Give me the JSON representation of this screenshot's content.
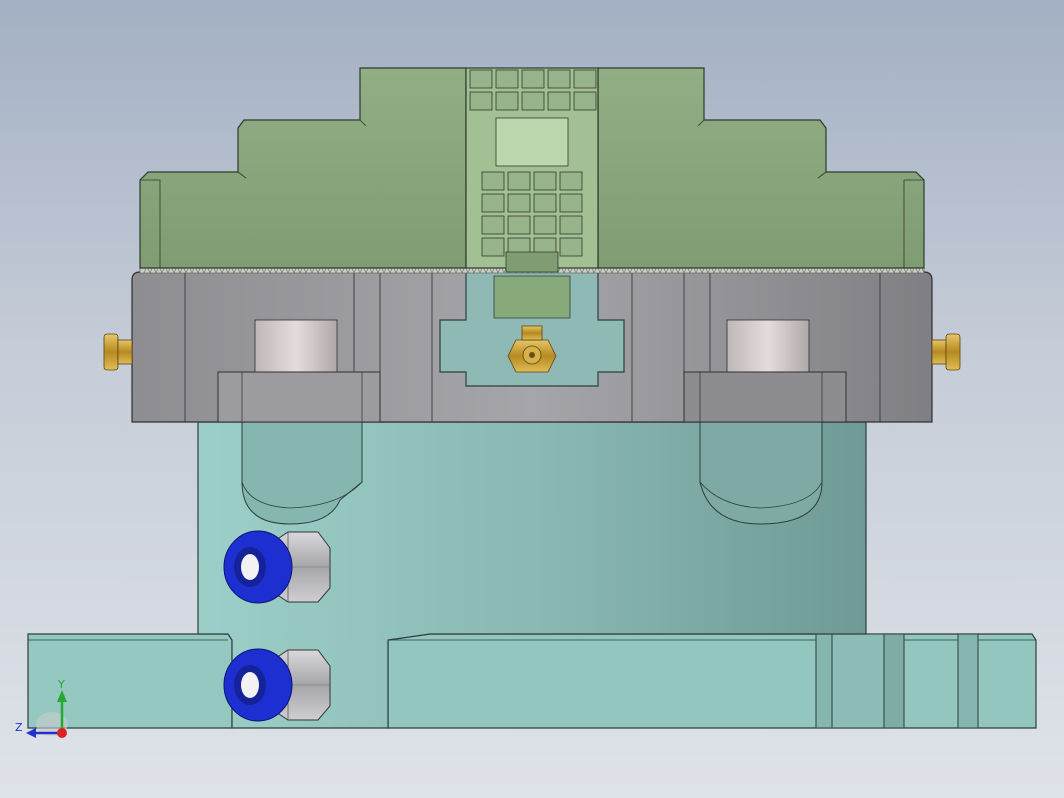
{
  "viewport": {
    "background_top": "#a3b0c3",
    "background_bottom": "#dfe3e9"
  },
  "model": {
    "description_visible": false,
    "colors": {
      "jaw_green": "#8aa57c",
      "jaw_green_light": "#a9c49a",
      "chuck_body_gray": "#8f8f93",
      "cylinder_teal": "#8ab9b4",
      "base_teal": "#93c6c0",
      "fitting_blue": "#1d2fd0",
      "fitting_nut": "#b8b8bc",
      "brass": "#c9a33a"
    }
  },
  "triad": {
    "y_label": "Y",
    "z_label": "Z",
    "y_color": "#22aa33",
    "z_color": "#2233cc",
    "x_color": "#dd2222"
  }
}
